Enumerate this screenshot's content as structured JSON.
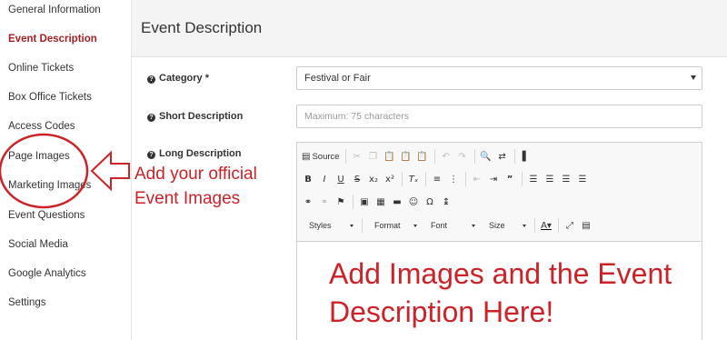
{
  "sidebar": {
    "items": [
      {
        "label": "General Information",
        "active": false
      },
      {
        "label": "Event Description",
        "active": true
      },
      {
        "label": "Online Tickets",
        "active": false
      },
      {
        "label": "Box Office Tickets",
        "active": false
      },
      {
        "label": "Access Codes",
        "active": false
      },
      {
        "label": "Page Images",
        "active": false
      },
      {
        "label": "Marketing Images",
        "active": false
      },
      {
        "label": "Event Questions",
        "active": false
      },
      {
        "label": "Social Media",
        "active": false
      },
      {
        "label": "Google Analytics",
        "active": false
      },
      {
        "label": "Settings",
        "active": false
      }
    ]
  },
  "header": {
    "title": "Event Description"
  },
  "form": {
    "category_label": "Category *",
    "category_value": "Festival or Fair",
    "short_label": "Short Description",
    "short_placeholder": "Maximum: 75 characters",
    "long_label": "Long Description"
  },
  "editor": {
    "source_label": "Source",
    "combos": {
      "styles": "Styles",
      "format": "Format",
      "font": "Font",
      "size": "Size"
    },
    "content_line1": "Add Images and the Event",
    "content_line2": "Description Here!"
  },
  "annotation": {
    "line1": "Add your official",
    "line2": "Event Images"
  },
  "colors": {
    "accent": "#a51f24",
    "annotation": "#cc2228"
  },
  "icons": {
    "help": "question-circle-icon",
    "arrow": "left-arrow-icon",
    "circle": "highlight-ellipse"
  }
}
